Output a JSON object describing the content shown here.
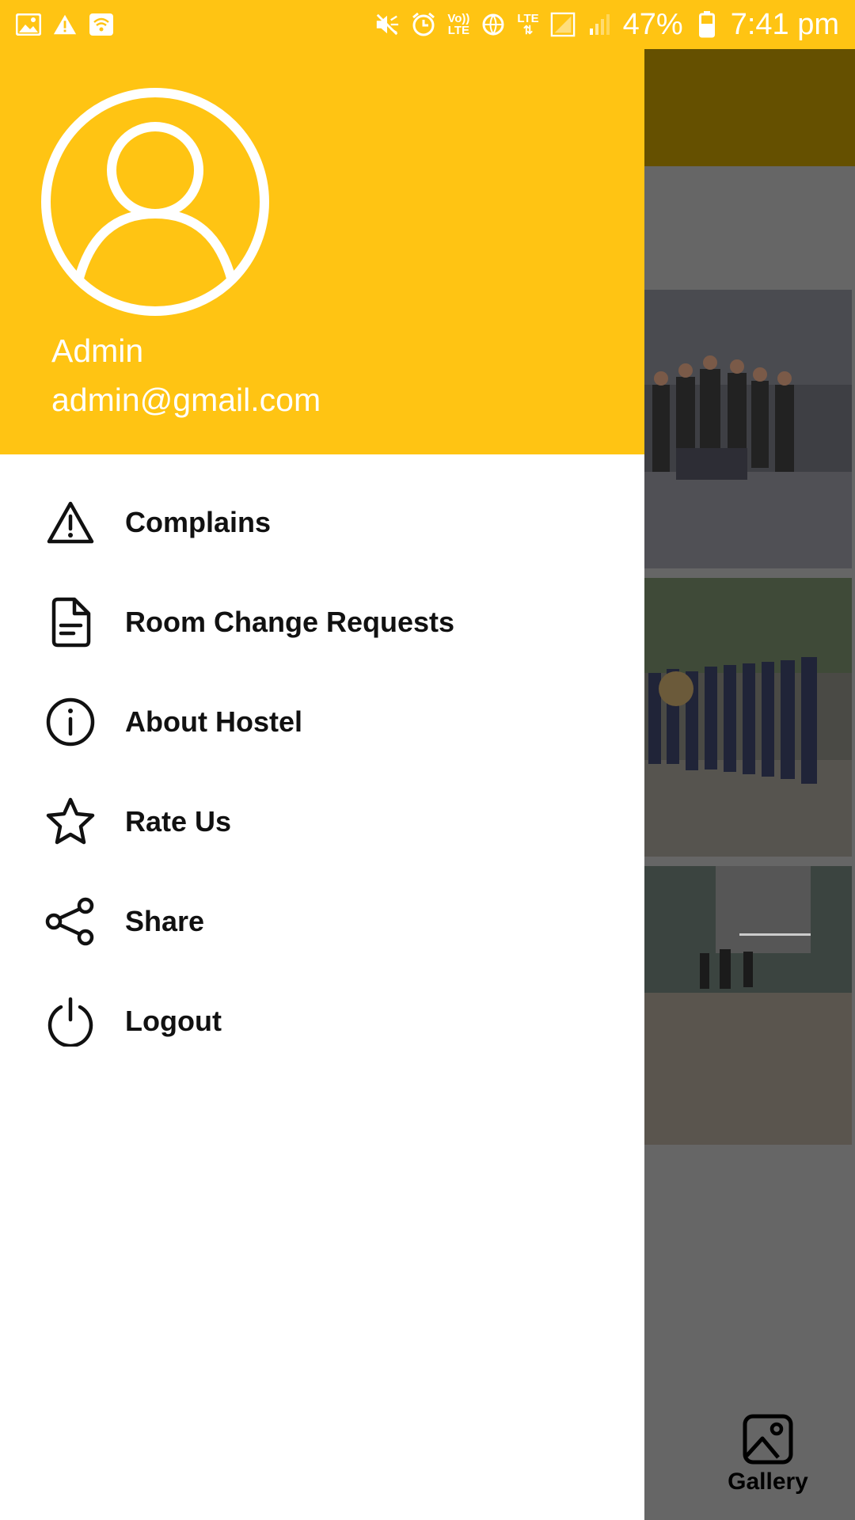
{
  "status_bar": {
    "battery": "47%",
    "time": "7:41 pm",
    "volte_top": "Vo))",
    "volte_bottom": "LTE",
    "lte_label": "LTE"
  },
  "drawer": {
    "user": {
      "name": "Admin",
      "email": "admin@gmail.com"
    },
    "items": [
      {
        "label": "Complains",
        "icon": "warning-triangle-icon"
      },
      {
        "label": "Room Change Requests",
        "icon": "document-icon"
      },
      {
        "label": "About Hostel",
        "icon": "info-icon"
      },
      {
        "label": "Rate Us",
        "icon": "star-icon"
      },
      {
        "label": "Share",
        "icon": "share-icon"
      },
      {
        "label": "Logout",
        "icon": "power-icon"
      }
    ]
  },
  "bottom_nav": {
    "gallery_label": "Gallery"
  },
  "colors": {
    "accent": "#FFC413",
    "scrim_toolbar": "#655000",
    "text": "#111111"
  }
}
